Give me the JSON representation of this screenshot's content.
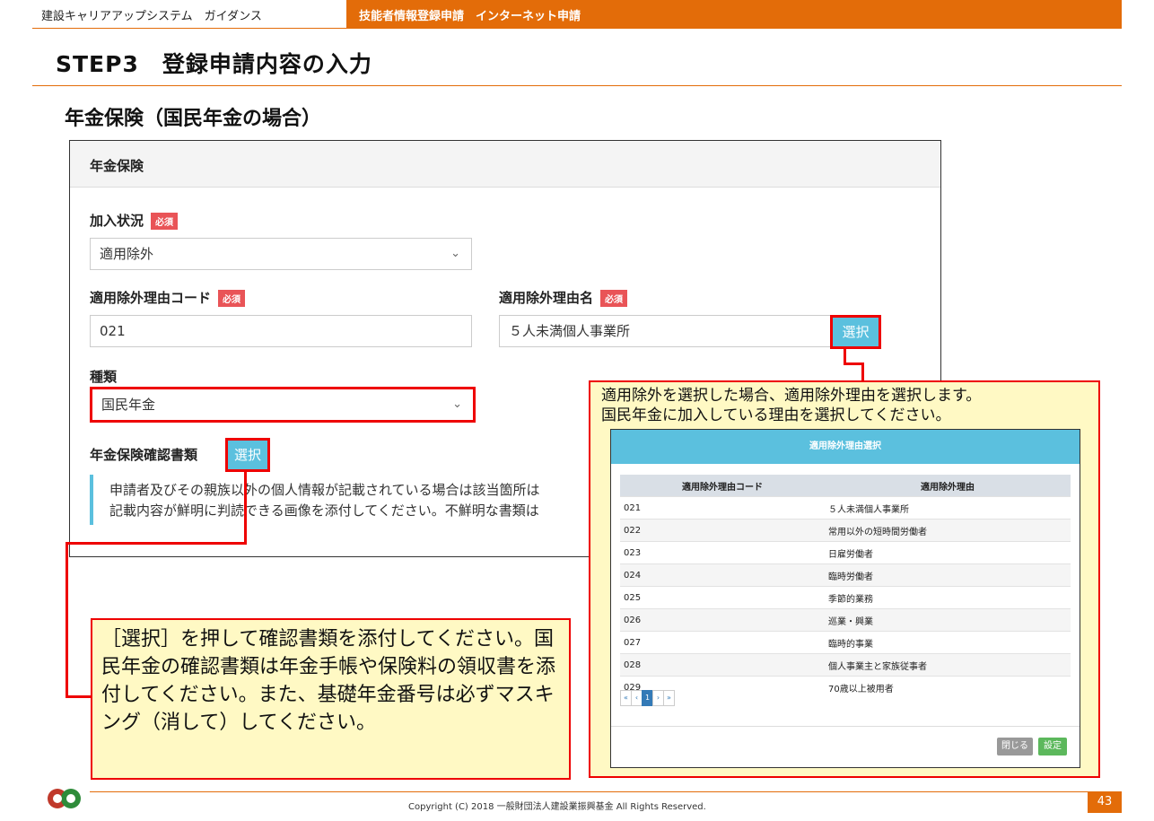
{
  "header": {
    "guide_title": "建設キャリアアップシステム　ガイダンス",
    "section": "技能者情報登録申請　インターネット申請"
  },
  "step_title": "STEP3　登録申請内容の入力",
  "section_title": "年金保険（国民年金の場合）",
  "panel": {
    "heading": "年金保険",
    "enroll_status": {
      "label": "加入状況",
      "required": "必須",
      "value": "適用除外"
    },
    "exemption_code": {
      "label": "適用除外理由コード",
      "required": "必須",
      "value": "021"
    },
    "exemption_name": {
      "label": "適用除外理由名",
      "required": "必須",
      "value": "５人未満個人事業所",
      "button": "選択"
    },
    "type": {
      "label": "種類",
      "value": "国民年金"
    },
    "doc": {
      "label": "年金保険確認書類",
      "button": "選択"
    },
    "notice_line1": "申請者及びその親族以外の個人情報が記載されている場合は該当箇所は",
    "notice_line2": "記載内容が鮮明に判読できる画像を添付してください。不鮮明な書類は"
  },
  "callout_right": {
    "line1": "適用除外を選択した場合、適用除外理由を選択します。",
    "line2": "国民年金に加入している理由を選択してください。"
  },
  "callout_left": {
    "text": "［選択］を押して確認書類を添付してください。国民年金の確認書類は年金手帳や保険料の領収書を添付してください。また、基礎年金番号は必ずマスキング（消して）してください。"
  },
  "modal": {
    "title": "適用除外理由選択",
    "columns": [
      "適用除外理由コード",
      "適用除外理由"
    ],
    "rows": [
      [
        "021",
        "５人未満個人事業所"
      ],
      [
        "022",
        "常用以外の短時間労働者"
      ],
      [
        "023",
        "日雇労働者"
      ],
      [
        "024",
        "臨時労働者"
      ],
      [
        "025",
        "季節的業務"
      ],
      [
        "026",
        "巡業・興業"
      ],
      [
        "027",
        "臨時的事業"
      ],
      [
        "028",
        "個人事業主と家族従事者"
      ],
      [
        "029",
        "70歳以上被用者"
      ]
    ],
    "pager": [
      "«",
      "‹",
      "1",
      "›",
      "»"
    ],
    "close_button": "閉じる",
    "set_button": "設定"
  },
  "footer": {
    "copyright": "Copyright (C) 2018 一般財団法人建設業振興基金 All Rights Reserved.",
    "page_number": "43"
  }
}
